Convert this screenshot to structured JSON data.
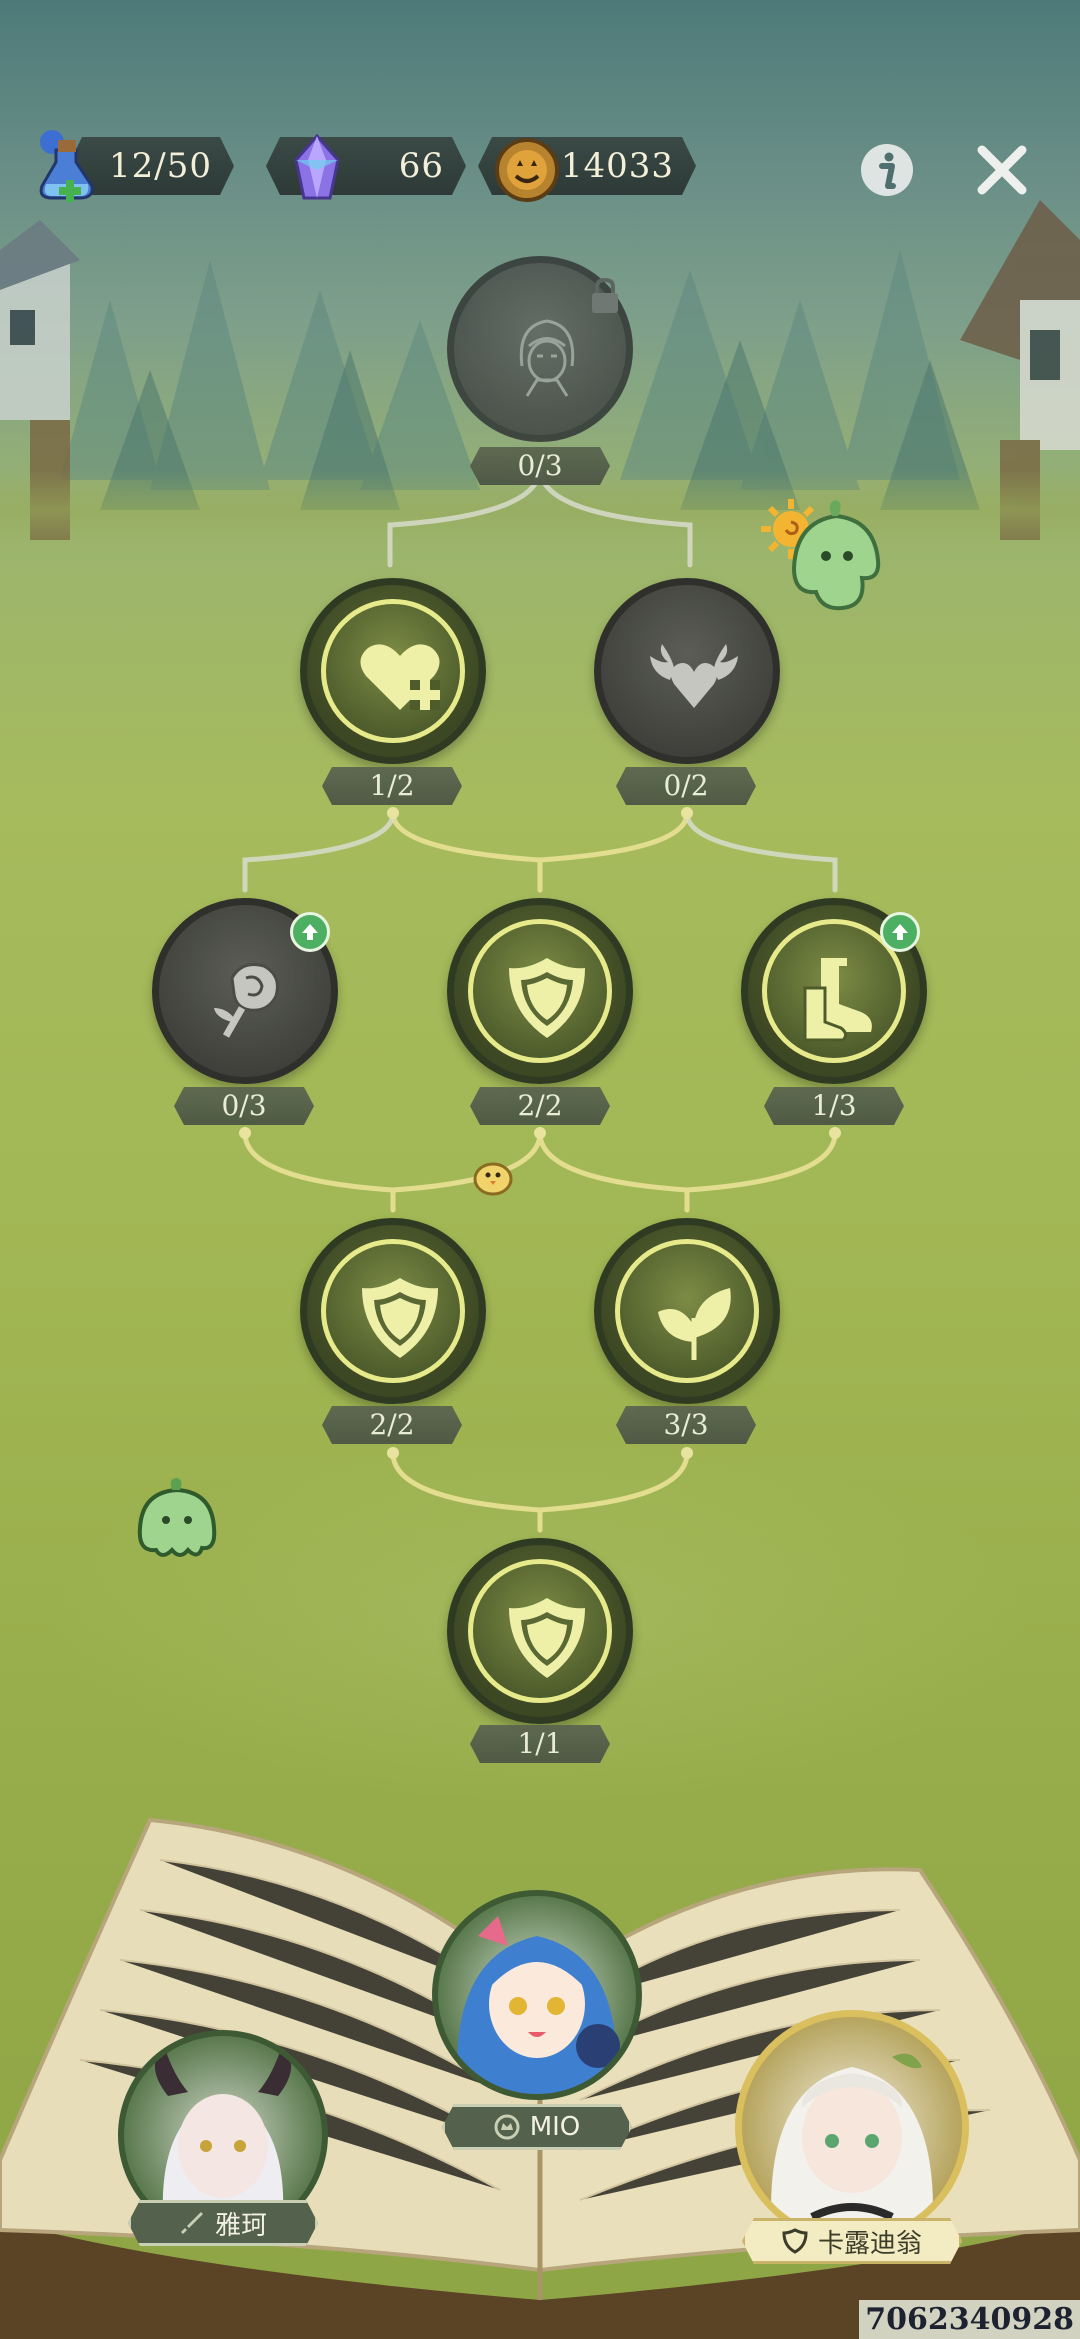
{
  "top_bar": {
    "stamina": "12/50",
    "gems": "66",
    "coins": "14033"
  },
  "tree": {
    "nodes": [
      {
        "id": "portrait",
        "count": "0/3",
        "state": "locked"
      },
      {
        "id": "heart-heal",
        "count": "1/2",
        "state": "active"
      },
      {
        "id": "heart-wings",
        "count": "0/2",
        "state": "inactive"
      },
      {
        "id": "rose",
        "count": "0/3",
        "state": "inactive",
        "upgrade": true
      },
      {
        "id": "shield-1",
        "count": "2/2",
        "state": "active"
      },
      {
        "id": "boots",
        "count": "1/3",
        "state": "active",
        "upgrade": true
      },
      {
        "id": "shield-2",
        "count": "2/2",
        "state": "active"
      },
      {
        "id": "leaf",
        "count": "3/3",
        "state": "active"
      },
      {
        "id": "shield-3",
        "count": "1/1",
        "state": "active"
      }
    ]
  },
  "heroes": [
    {
      "name": "雅珂",
      "role": "sword"
    },
    {
      "name": "MIO",
      "role": "crown"
    },
    {
      "name": "卡露迪翁",
      "role": "shield"
    }
  ],
  "user_id": "7062340928"
}
